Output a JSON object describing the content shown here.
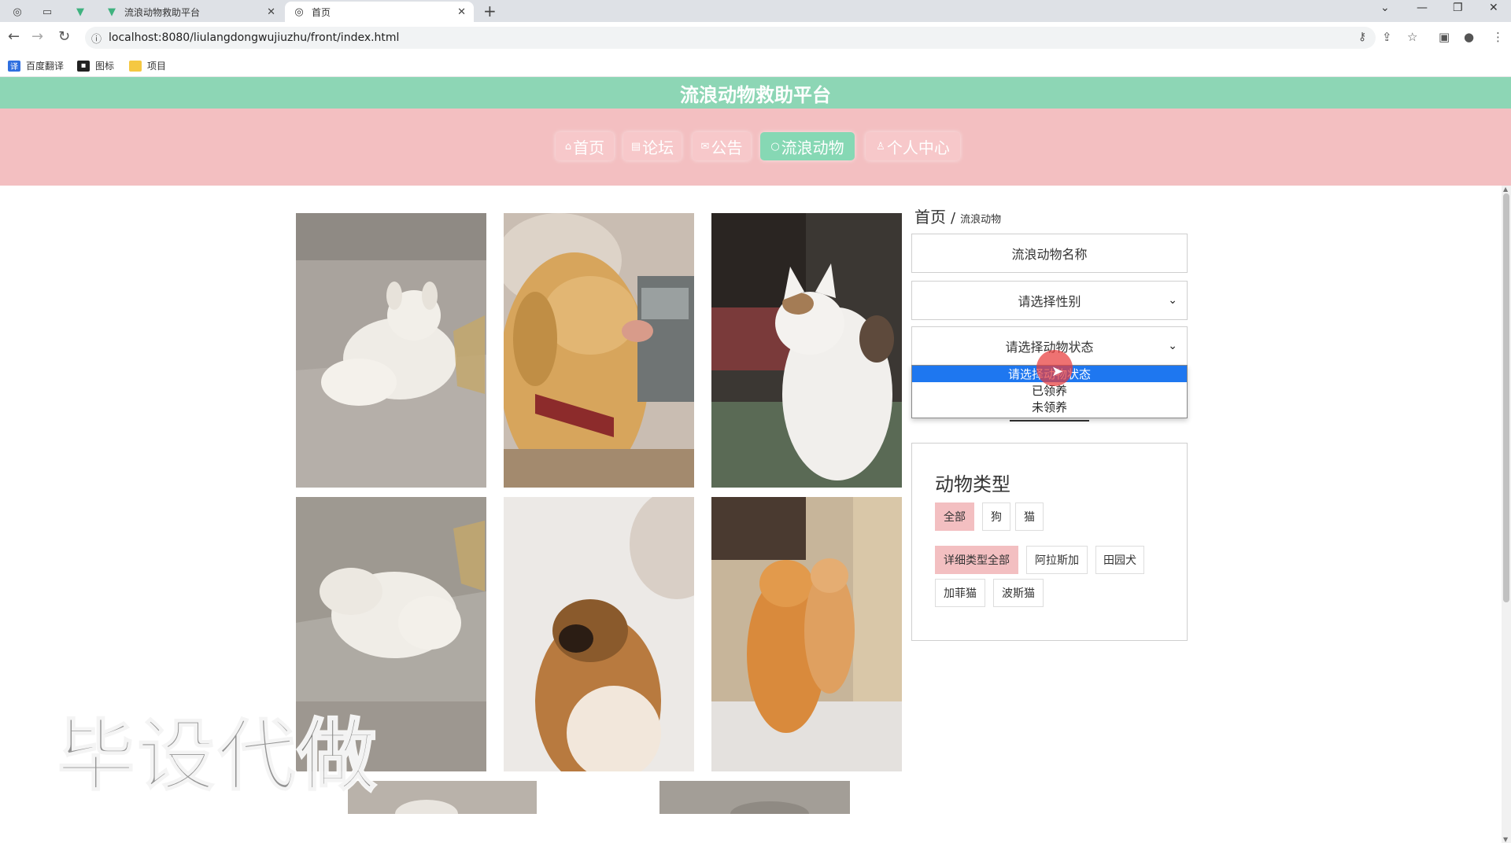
{
  "browser": {
    "tabs": [
      {
        "title": "流浪动物救助平台",
        "icon": "vue-logo-icon"
      },
      {
        "title": "首页",
        "icon": "globe-icon"
      }
    ],
    "url": "localhost:8080/liulangdongwujiuzhu/front/index.html",
    "bookmarks": [
      "百度翻译",
      "图标",
      "项目"
    ]
  },
  "site": {
    "title": "流浪动物救助平台",
    "nav": [
      {
        "label": "首页",
        "icon": "home-icon",
        "active": false
      },
      {
        "label": "论坛",
        "icon": "forum-icon",
        "active": false
      },
      {
        "label": "公告",
        "icon": "mail-icon",
        "active": false
      },
      {
        "label": "流浪动物",
        "icon": "paw-icon",
        "active": true
      },
      {
        "label": "个人中心",
        "icon": "user-icon",
        "active": false
      }
    ]
  },
  "breadcrumb": {
    "home": "首页",
    "sep": "/",
    "current": "流浪动物"
  },
  "filters": {
    "name_placeholder": "流浪动物名称",
    "gender_select": "请选择性别",
    "status_select": "请选择动物状态",
    "status_options": [
      "请选择动物状态",
      "已领养",
      "未领养"
    ],
    "status_selected_index": 0
  },
  "animal_type": {
    "title": "动物类型",
    "types": [
      "全部",
      "狗",
      "猫"
    ],
    "active_type": "全部",
    "details": [
      "详细类型全部",
      "阿拉斯加",
      "田园犬",
      "加菲猫",
      "波斯猫"
    ],
    "active_detail": "详细类型全部"
  },
  "gallery": [
    {
      "subject": "white-puppy-lying"
    },
    {
      "subject": "golden-retriever-with-hand"
    },
    {
      "subject": "white-calico-cat"
    },
    {
      "subject": "white-puppy-resting"
    },
    {
      "subject": "pekingese-dog"
    },
    {
      "subject": "orange-cats"
    },
    {
      "subject": "partial-photo"
    },
    {
      "subject": "partial-photo"
    }
  ],
  "watermark": "毕设代做",
  "colors": {
    "header_green": "#8dd6b5",
    "nav_pink": "#f3bfc1",
    "active_green": "#86d8b4",
    "select_blue": "#1e77f0"
  }
}
